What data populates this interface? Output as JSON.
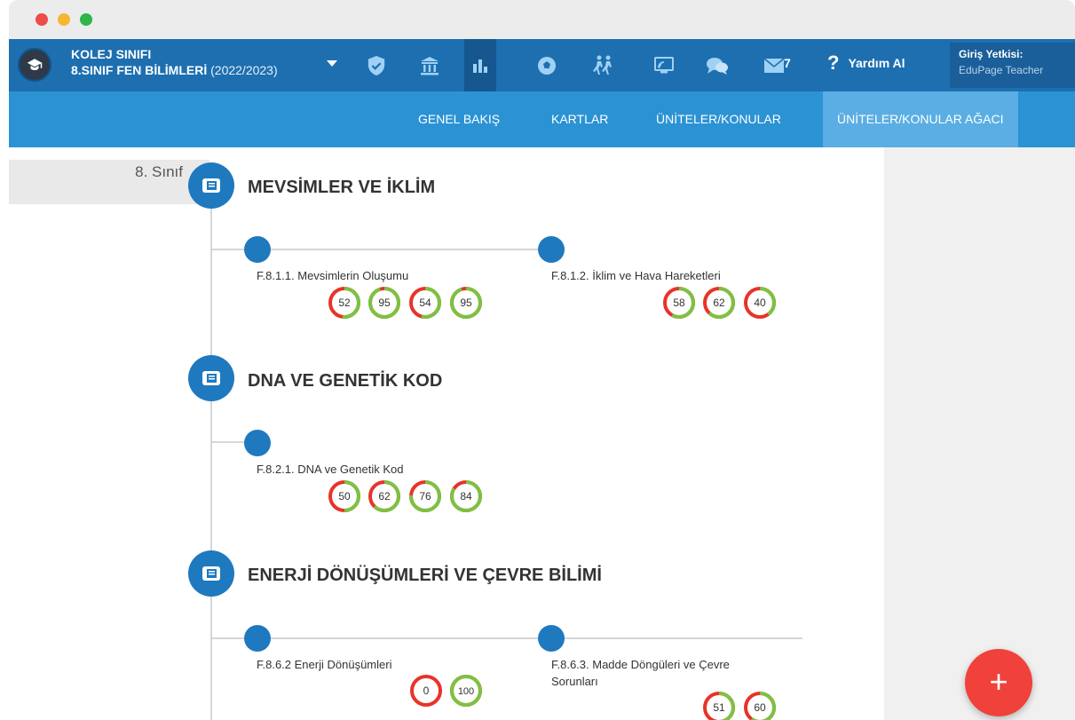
{
  "header": {
    "school": "KOLEJ SINIFI",
    "class_name": "8.SINIF FEN BİLİMLERİ",
    "year": "(2022/2023)",
    "icons": [
      "shield-icon",
      "school-building-icon",
      "bar-chart-icon",
      "soccer-ball-icon",
      "people-walking-icon",
      "presentation-icon",
      "chat-bubbles-icon",
      "mail-icon"
    ],
    "mail_count": "7",
    "help_label": "Yardım Al",
    "login_label": "Giriş Yetkisi:",
    "login_value": "EduPage Teacher"
  },
  "tabs": [
    {
      "label": "GENEL BAKIŞ"
    },
    {
      "label": "KARTLAR"
    },
    {
      "label": "ÜNİTELER/KONULAR"
    },
    {
      "label": "ÜNİTELER/KONULAR AĞACI",
      "active": true
    }
  ],
  "grade": "8. Sınıf",
  "units": [
    {
      "title": "MEVSİMLER VE İKLİM",
      "topics": [
        {
          "name": "F.8.1.1. Mevsimlerin Oluşumu",
          "scores": [
            52,
            95,
            54,
            95
          ]
        },
        {
          "name": "F.8.1.2. İklim ve Hava Hareketleri",
          "scores": [
            58,
            62,
            40
          ]
        }
      ]
    },
    {
      "title": "DNA VE GENETİK KOD",
      "topics": [
        {
          "name": "F.8.2.1. DNA ve Genetik Kod",
          "scores": [
            50,
            62,
            76,
            84
          ]
        }
      ]
    },
    {
      "title": "ENERJİ DÖNÜŞÜMLERİ VE ÇEVRE BİLİMİ",
      "topics": [
        {
          "name": "F.8.6.2 Enerji Dönüşümleri",
          "scores": [
            0,
            100
          ]
        },
        {
          "name": "F.8.6.3. Madde Döngüleri ve Çevre",
          "name_line2": "Sorunları",
          "scores": [
            51,
            60
          ]
        }
      ]
    }
  ],
  "colors": {
    "nav": "#1d6fb0",
    "tabs": "#2b93d4",
    "accent": "#1f79bf",
    "good": "#7cc242",
    "bad": "#e8332a",
    "fab": "#f0423a"
  },
  "fab_label": "+"
}
